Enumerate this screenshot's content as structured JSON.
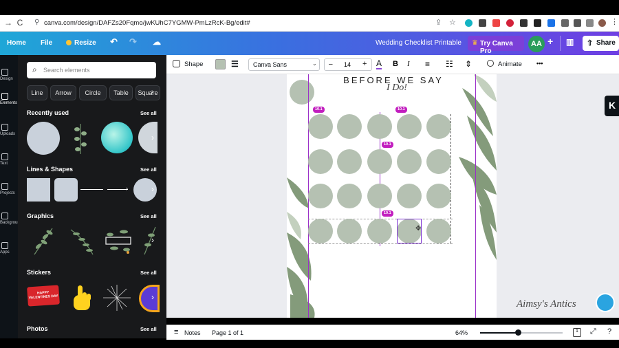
{
  "browser": {
    "url": "canva.com/design/DAFZs20Fqmo/jwKUhC7YGMW-PmLzRcK-Bg/edit#"
  },
  "topbar": {
    "home": "Home",
    "file": "File",
    "resize": "Resize",
    "title": "Wedding Checklist Printable",
    "try_pro": "Try Canva Pro",
    "avatar": "AA",
    "share": "Share",
    "colors": {
      "gradient_start": "#1fa7d7",
      "gradient_end": "#6f3fe3",
      "avatar": "#2a9d5b"
    }
  },
  "rail": {
    "items": [
      "Design",
      "Elements",
      "Uploads",
      "Text",
      "Projects",
      "Background",
      "Apps"
    ]
  },
  "panel": {
    "search_placeholder": "Search elements",
    "pills": [
      "Line",
      "Arrow",
      "Circle",
      "Table",
      "Square"
    ],
    "see_all": "See all",
    "sections": {
      "recently_used": "Recently used",
      "lines_shapes": "Lines & Shapes",
      "graphics": "Graphics",
      "stickers": "Stickers",
      "photos": "Photos"
    },
    "sticker_text": "HAPPY VALENTINES DAY"
  },
  "toolbar": {
    "shape": "Shape",
    "shape_color": "#b5c1b2",
    "font": "Canva Sans",
    "font_size": "14",
    "minus": "–",
    "plus": "+",
    "bold": "B",
    "italic": "I",
    "animate": "Animate",
    "more": "•••"
  },
  "page": {
    "heading": "BEFORE WE SAY",
    "script_text": "I Do!",
    "badges": [
      "10.1",
      "10.1",
      "10.1",
      "10.1"
    ],
    "circle_color": "#b5c1b2",
    "guide_color": "#9b30c9",
    "watermark": "Aimsy's Antics"
  },
  "statusbar": {
    "notes": "Notes",
    "page": "Page 1 of 1",
    "zoom": "64%"
  }
}
